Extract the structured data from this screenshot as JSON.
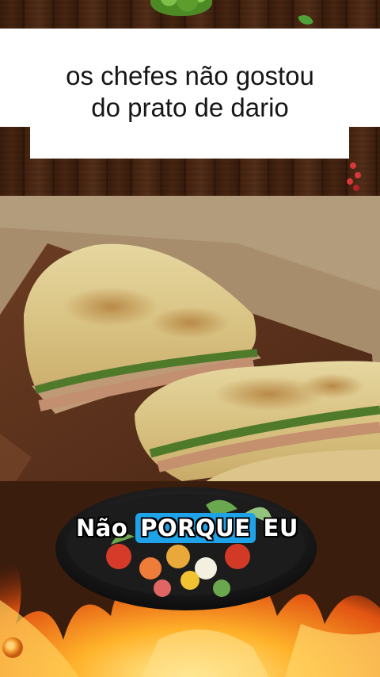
{
  "title": {
    "line1": "os chefes não gostou",
    "line2": "do prato de dario"
  },
  "caption": {
    "word1": "Não",
    "word2": "PORQUE",
    "word3": "EU",
    "highlight_color": "#1fa3e8"
  },
  "colors": {
    "title_card": "#ffffff",
    "title_text": "#161616",
    "wood": "#3a1d0d"
  },
  "icons": {
    "top_decoration": "broccoli-icon",
    "leaf": "leaf-icon",
    "berries": "berries-icon",
    "orb": "fire-orb-icon"
  }
}
